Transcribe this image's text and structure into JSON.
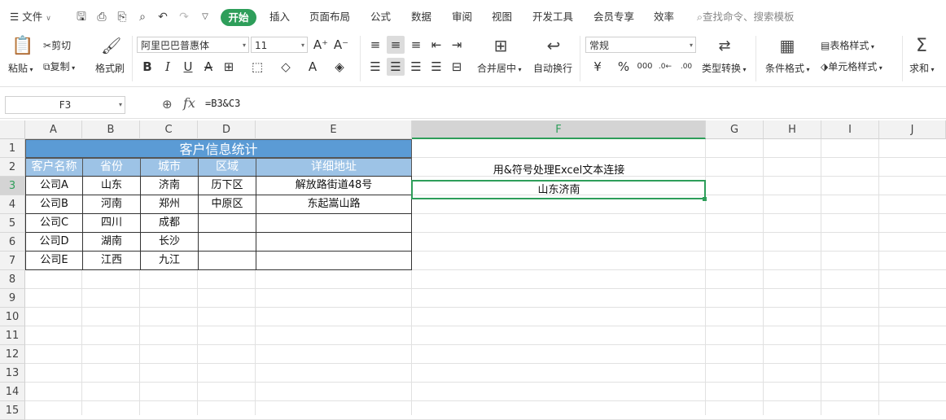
{
  "menubar": {
    "file_label": "文件",
    "tabs": [
      "开始",
      "插入",
      "页面布局",
      "公式",
      "数据",
      "审阅",
      "视图",
      "开发工具",
      "会员专享",
      "效率"
    ],
    "search_placeholder": "查找命令、搜索模板"
  },
  "ribbon": {
    "paste": "粘贴",
    "cut": "剪切",
    "copy": "复制",
    "format_painter": "格式刷",
    "font_name": "阿里巴巴普惠体",
    "font_size": "11",
    "merge_center": "合并居中",
    "wrap_text": "自动换行",
    "number_format": "常规",
    "type_convert": "类型转换",
    "conditional_format": "条件格式",
    "table_style": "表格样式",
    "cell_style": "单元格样式",
    "sum": "求和"
  },
  "formula_bar": {
    "name_box": "F3",
    "formula": "=B3&C3"
  },
  "columns": [
    "A",
    "B",
    "C",
    "D",
    "E",
    "F",
    "G",
    "H",
    "I",
    "J"
  ],
  "rows": [
    "1",
    "2",
    "3",
    "4",
    "5",
    "6",
    "7",
    "8",
    "9",
    "10",
    "11",
    "12",
    "13",
    "14",
    "15"
  ],
  "sheet": {
    "title": "客户信息统计",
    "headers": [
      "客户名称",
      "省份",
      "城市",
      "区域",
      "详细地址"
    ],
    "data": [
      [
        "公司A",
        "山东",
        "济南",
        "历下区",
        "解放路街道48号"
      ],
      [
        "公司B",
        "河南",
        "郑州",
        "中原区",
        "东起嵩山路"
      ],
      [
        "公司C",
        "四川",
        "成都",
        "",
        ""
      ],
      [
        "公司D",
        "湖南",
        "长沙",
        "",
        ""
      ],
      [
        "公司E",
        "江西",
        "九江",
        "",
        ""
      ]
    ],
    "f2_note": "用&符号处理Excel文本连接",
    "f3_result": "山东济南"
  },
  "colors": {
    "accent": "#2e9e5a",
    "header_fill": "#9dc3e6",
    "title_fill": "#5b9bd5"
  }
}
